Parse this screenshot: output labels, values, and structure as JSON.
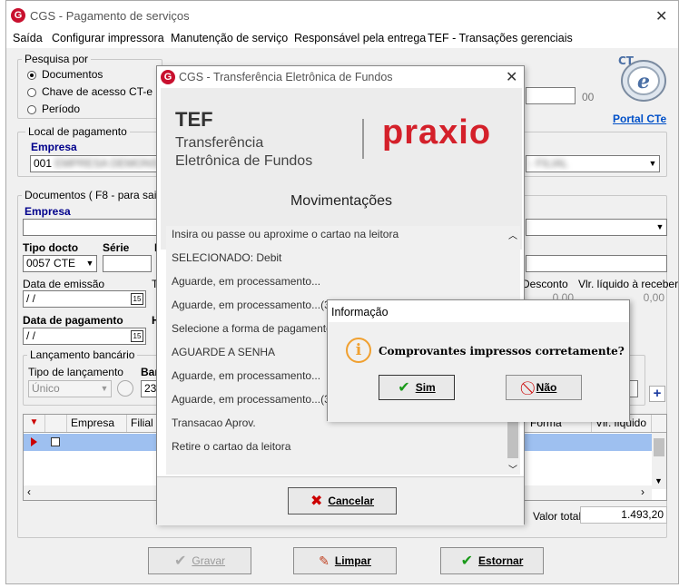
{
  "main": {
    "title": "CGS - Pagamento de serviços",
    "menu": [
      "Saída",
      "Configurar impressora",
      "Manutenção de serviço",
      "Responsável pela entrega",
      "TEF - Transações gerenciais"
    ],
    "search": {
      "legend": "Pesquisa por",
      "options": [
        "Documentos",
        "Chave de acesso CT-e",
        "Período"
      ],
      "selected": "Documentos"
    },
    "partial_field_value": "00",
    "portal_label": "Portal CTe",
    "local": {
      "legend": "Local de pagamento",
      "empresa_label": "Empresa",
      "empresa_value": "001",
      "empresa_blurred": "EMPRESA DEMONSTRACAO LTDA",
      "right_blurred": "- FILIAL"
    },
    "docs": {
      "legend": "Documentos ( F8 - para sair )",
      "empresa_label": "Empresa",
      "tipo_docto_label": "Tipo docto",
      "tipo_docto_value": "0057 CTE",
      "serie_label": "Série",
      "data_emissao_label": "Data de emissão",
      "data_emissao_value": " / /",
      "data_pagamento_label": "Data de pagamento",
      "data_pagamento_value": " / /",
      "desconto_label": "Desconto",
      "desconto_value": "0,00",
      "vlr_liquido_label": "Vlr. líquido à receber",
      "vlr_liquido_value": "0,00",
      "cal_icon_text": "15"
    },
    "lanc": {
      "legend": "Lançamento bancário",
      "tipo_label": "Tipo de lançamento",
      "tipo_value": "Único",
      "banco_partial": "Bar",
      "banco_value": "237"
    },
    "grid": {
      "columns": [
        "Empresa",
        "Filial"
      ],
      "columns_right": [
        "Forma pagto",
        "Vlr. líquido"
      ]
    },
    "valor_total_label": "Valor total",
    "valor_total_value": "1.493,20",
    "buttons": {
      "gravar": "Gravar",
      "limpar": "Limpar",
      "estornar": "Estornar"
    }
  },
  "tef": {
    "title": "CGS - Transferência Eletrônica de Fundos",
    "banner_tef": "TEF",
    "banner_line1": "Transferência",
    "banner_line2": "Eletrônica de Fundos",
    "brand": "praxio",
    "heading": "Movimentações",
    "lines": [
      "Insira ou passe ou aproxime o cartao na leitora",
      "SELECIONADO:   Debit",
      "Aguarde, em processamento...",
      "Aguarde, em processamento...(35)",
      "Selecione a forma de pagamento",
      "AGUARDE A SENHA",
      "Aguarde, em processamento...",
      "Aguarde, em processamento...(35)",
      "Transacao Aprov.",
      "Retire o cartao da leitora"
    ],
    "cancel_label": "Cancelar"
  },
  "info": {
    "title": "Informação",
    "message": "Comprovantes impressos corretamente?",
    "yes_label": "Sim",
    "no_label": "Não"
  },
  "colors": {
    "accent_red": "#c8102e",
    "brand_red": "#d4202a",
    "link_blue": "#00008b",
    "info_orange": "#f0a030",
    "check_green": "#1a9a1a"
  }
}
